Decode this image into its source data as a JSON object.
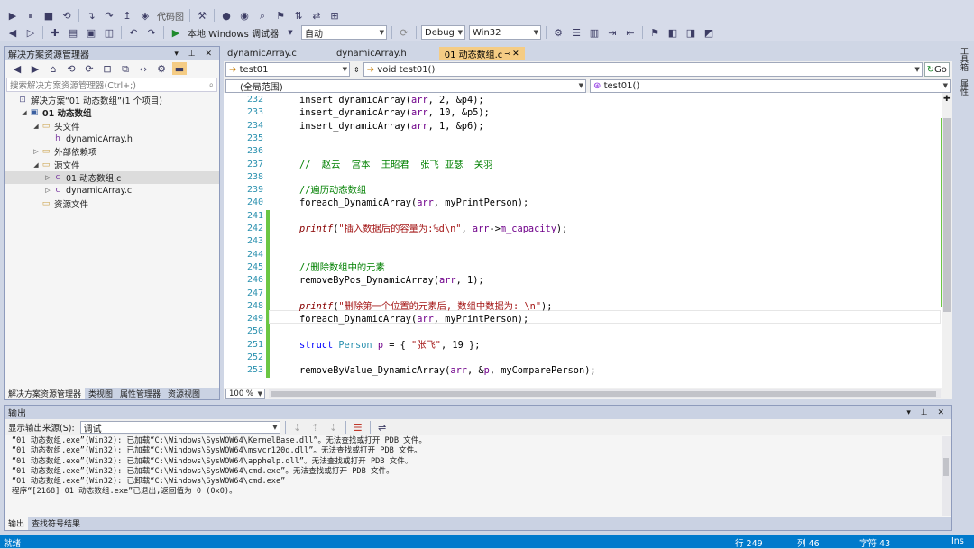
{
  "toolbar": {
    "code_map": "代码图",
    "local_debugger": "本地 Windows 调试器",
    "auto": "自动",
    "config": "Debug",
    "platform": "Win32"
  },
  "solution_explorer": {
    "title": "解决方案资源管理器",
    "search_placeholder": "搜索解决方案资源管理器(Ctrl+;)",
    "tree": [
      {
        "label": "解决方案“01 动态数组”(1 个项目)",
        "indent": 0,
        "icon": "solution-icon"
      },
      {
        "label": "01 动态数组",
        "indent": 1,
        "icon": "project-icon",
        "bold": true
      },
      {
        "label": "头文件",
        "indent": 2,
        "icon": "folder-icon"
      },
      {
        "label": "dynamicArray.h",
        "indent": 3,
        "icon": "header-file-icon"
      },
      {
        "label": "外部依赖项",
        "indent": 2,
        "icon": "folder-icon"
      },
      {
        "label": "源文件",
        "indent": 2,
        "icon": "folder-icon"
      },
      {
        "label": "01 动态数组.c",
        "indent": 3,
        "icon": "c-file-icon",
        "selected": true
      },
      {
        "label": "dynamicArray.c",
        "indent": 3,
        "icon": "c-file-icon"
      },
      {
        "label": "资源文件",
        "indent": 2,
        "icon": "folder-icon"
      }
    ],
    "bottom_tabs": [
      "解决方案资源管理器",
      "类视图",
      "属性管理器",
      "资源视图"
    ]
  },
  "editor": {
    "tabs": [
      {
        "label": "dynamicArray.c",
        "active": false
      },
      {
        "label": "dynamicArray.h",
        "active": false
      },
      {
        "label": "01 动态数组.c",
        "active": true
      }
    ],
    "nav_left": "test01",
    "nav_right": "void test01()",
    "scope_left": "(全局范围)",
    "scope_right": "test01()",
    "go_label": "Go",
    "zoom": "100 %",
    "code": [
      {
        "n": "232",
        "t": "insert_dynamicArray(arr, 2, &p4);"
      },
      {
        "n": "233",
        "t": "insert_dynamicArray(arr, 10, &p5);"
      },
      {
        "n": "234",
        "t": "insert_dynamicArray(arr, 1, &p6);"
      },
      {
        "n": "235",
        "t": ""
      },
      {
        "n": "236",
        "t": ""
      },
      {
        "n": "237",
        "t": "//  赵云  宫本  王昭君  张飞 亚瑟  关羽"
      },
      {
        "n": "238",
        "t": ""
      },
      {
        "n": "239",
        "t": "//遍历动态数组"
      },
      {
        "n": "240",
        "t": "foreach_DynamicArray(arr, myPrintPerson);"
      },
      {
        "n": "241",
        "t": ""
      },
      {
        "n": "242",
        "t": "printf(\"插入数据后的容量为:%d\\n\", arr->m_capacity);"
      },
      {
        "n": "243",
        "t": ""
      },
      {
        "n": "244",
        "t": ""
      },
      {
        "n": "245",
        "t": "//删除数组中的元素"
      },
      {
        "n": "246",
        "t": "removeByPos_DynamicArray(arr, 1);"
      },
      {
        "n": "247",
        "t": ""
      },
      {
        "n": "248",
        "t": "printf(\"删除第一个位置的元素后, 数组中数据为: \\n\");"
      },
      {
        "n": "249",
        "t": "foreach_DynamicArray(arr, myPrintPerson);"
      },
      {
        "n": "250",
        "t": ""
      },
      {
        "n": "251",
        "t": "struct Person p = { \"张飞\", 19 };"
      },
      {
        "n": "252",
        "t": ""
      },
      {
        "n": "253",
        "t": "removeByValue_DynamicArray(arr, &p, myComparePerson);"
      }
    ]
  },
  "output": {
    "title": "输出",
    "source_label": "显示输出来源(S):",
    "source_value": "调试",
    "lines": [
      "“01 动态数组.exe”(Win32): 已加载“C:\\Windows\\SysWOW64\\KernelBase.dll”。无法查找或打开 PDB 文件。",
      "“01 动态数组.exe”(Win32): 已加载“C:\\Windows\\SysWOW64\\msvcr120d.dll”。无法查找或打开 PDB 文件。",
      "“01 动态数组.exe”(Win32): 已加载“C:\\Windows\\SysWOW64\\apphelp.dll”。无法查找或打开 PDB 文件。",
      "“01 动态数组.exe”(Win32): 已加载“C:\\Windows\\SysWOW64\\cmd.exe”。无法查找或打开 PDB 文件。",
      "“01 动态数组.exe”(Win32): 已卸载“C:\\Windows\\SysWOW64\\cmd.exe”",
      "程序“[2168] 01 动态数组.exe”已退出,返回值为 0 (0x0)。"
    ],
    "tabs": [
      "输出",
      "查找符号结果"
    ]
  },
  "right_strip": [
    "工具箱",
    "属性"
  ],
  "status": {
    "ready": "就绪",
    "line": "行 249",
    "col": "列 46",
    "ch": "字符 43",
    "ins": "Ins"
  }
}
